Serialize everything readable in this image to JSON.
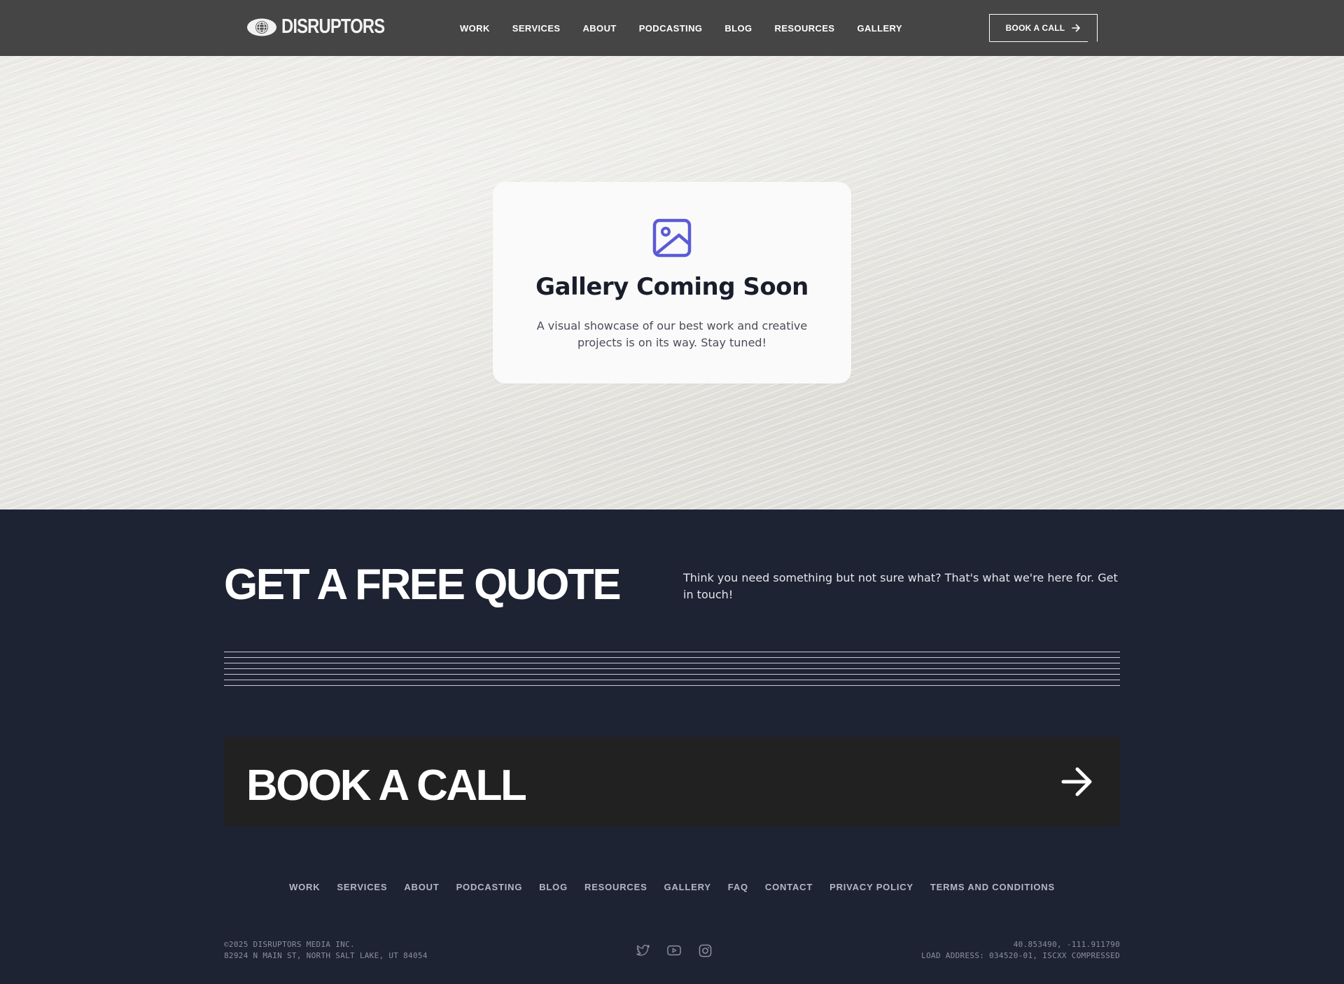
{
  "header": {
    "logo_text": "DISRUPTORS",
    "logo_icon": "globe-eye-icon",
    "nav": [
      "WORK",
      "SERVICES",
      "ABOUT",
      "PODCASTING",
      "BLOG",
      "RESOURCES",
      "GALLERY"
    ],
    "cta_label": "BOOK A CALL",
    "cta_icon": "arrow-right-icon",
    "background": "#454545"
  },
  "hero": {
    "icon": "image-icon",
    "icon_color": "#5b5bd6",
    "title": "Gallery Coming Soon",
    "description": "A visual showcase of our best work and creative projects is on its way. Stay tuned!"
  },
  "quote": {
    "title": "GET A FREE QUOTE",
    "text": "Think you need something but not sure what? That's what we're here for. Get in touch!",
    "book_label": "BOOK A CALL",
    "book_icon": "arrow-right-icon",
    "background": "#1e2333"
  },
  "footer": {
    "nav": [
      "WORK",
      "SERVICES",
      "ABOUT",
      "PODCASTING",
      "BLOG",
      "RESOURCES",
      "GALLERY",
      "FAQ",
      "CONTACT",
      "PRIVACY POLICY",
      "TERMS AND CONDITIONS"
    ],
    "copyright": "©2025 DISRUPTORS MEDIA INC.",
    "address": "82924 N MAIN ST, NORTH SALT LAKE, UT 84054",
    "coordinates": "40.853490, -111.911790",
    "load_address": "LOAD ADDRESS: 034520-01, ISCXX COMPRESSED",
    "socials": [
      "twitter-icon",
      "youtube-icon",
      "instagram-icon"
    ]
  }
}
